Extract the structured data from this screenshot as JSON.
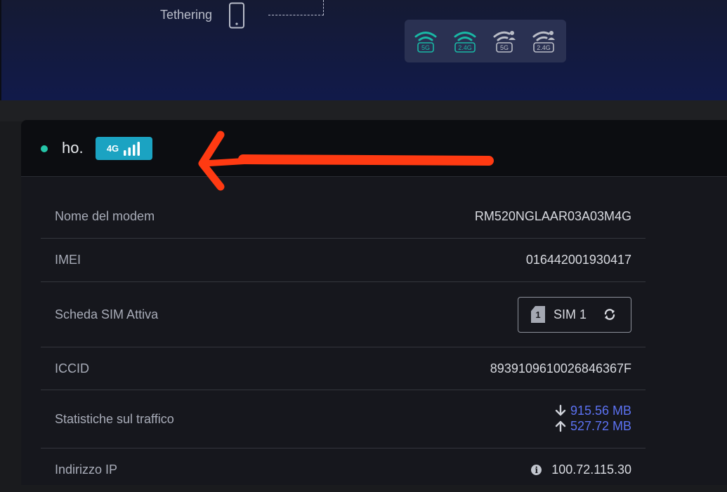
{
  "top": {
    "tethering_label": "Tethering",
    "wifi_bands": [
      {
        "label": "5G",
        "icon": "wifi-icon",
        "color": "#19b8a5",
        "mode": "main"
      },
      {
        "label": "2.4G",
        "icon": "wifi-icon",
        "color": "#19b8a5",
        "mode": "main"
      },
      {
        "label": "5G",
        "icon": "wifi-guest-icon",
        "color": "#b9bcc6",
        "mode": "guest"
      },
      {
        "label": "2.4G",
        "icon": "wifi-guest-icon",
        "color": "#b9bcc6",
        "mode": "guest"
      }
    ]
  },
  "header": {
    "operator": "ho.",
    "network_type": "4G",
    "status_color": "#25c5a8",
    "badge_color": "#1ba3c2",
    "annotation_color": "#ff3a12"
  },
  "details": {
    "modem_name_label": "Nome del modem",
    "modem_name_value": "RM520NGLAAR03A03M4G",
    "imei_label": "IMEI",
    "imei_value": "016442001930417",
    "sim_label": "Scheda SIM Attiva",
    "sim_slot": "1",
    "sim_value": "SIM 1",
    "iccid_label": "ICCID",
    "iccid_value": "8939109610026846367F",
    "traffic_label": "Statistiche sul traffico",
    "traffic_down": "915.56 MB",
    "traffic_up": "527.72 MB",
    "ip_label": "Indirizzo IP",
    "ip_info_glyph": "i",
    "ip_value": "100.72.115.30"
  }
}
